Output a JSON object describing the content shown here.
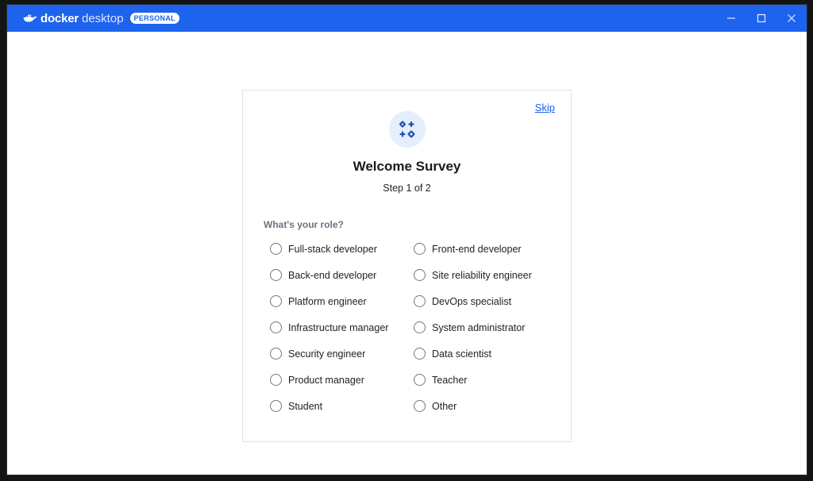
{
  "window": {
    "brand_primary": "docker",
    "brand_secondary": "desktop",
    "plan_badge": "PERSONAL",
    "controls": {
      "minimize_icon": "minimize-icon",
      "maximize_icon": "maximize-icon",
      "close_icon": "close-icon"
    },
    "accent_color": "#1d63ed"
  },
  "survey": {
    "skip_label": "Skip",
    "icon": "sparkles-icon",
    "title": "Welcome Survey",
    "step": "Step 1 of 2",
    "question": "What's your role?",
    "options": [
      {
        "label": "Full-stack developer",
        "selected": false
      },
      {
        "label": "Front-end developer",
        "selected": false
      },
      {
        "label": "Back-end developer",
        "selected": false
      },
      {
        "label": "Site reliability engineer",
        "selected": false
      },
      {
        "label": "Platform engineer",
        "selected": false
      },
      {
        "label": "DevOps specialist",
        "selected": false
      },
      {
        "label": "Infrastructure manager",
        "selected": false
      },
      {
        "label": "System administrator",
        "selected": false
      },
      {
        "label": "Security engineer",
        "selected": false
      },
      {
        "label": "Data scientist",
        "selected": false
      },
      {
        "label": "Product manager",
        "selected": false
      },
      {
        "label": "Teacher",
        "selected": false
      },
      {
        "label": "Student",
        "selected": false
      },
      {
        "label": "Other",
        "selected": false
      }
    ]
  }
}
